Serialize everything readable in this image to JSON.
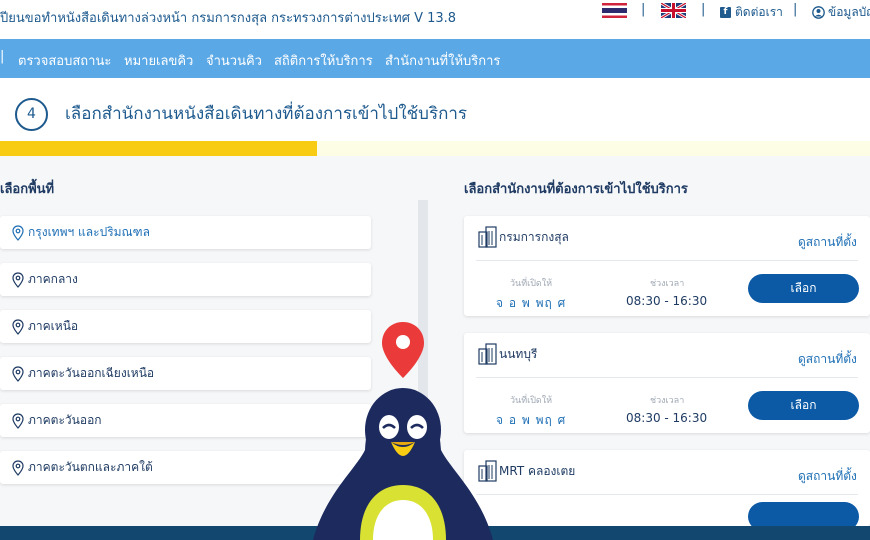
{
  "header": {
    "site_title": "ปียนขอทำหนังสือเดินทางล่วงหน้า กรมการกงสุล กระทรวงการต่างประเทศ V 13.8",
    "contact_label": "ติดต่อเรา",
    "user_label": "ข้อมูลบัญ"
  },
  "nav": {
    "items": [
      "ตรวจสอบสถานะ",
      "หมายเลขคิว",
      "จำนวนคิว",
      "สถิติการให้บริการ",
      "สำนักงานที่ให้บริการ"
    ]
  },
  "step": {
    "number": "4",
    "title": "เลือกสำนักงานหนังสือเดินทางที่ต้องการเข้าไปใช้บริการ",
    "progress_fraction": 0.364
  },
  "regions": {
    "title": "เลือกพื้นที่",
    "items": [
      {
        "label": "กรุงเทพฯ และปริมณฑล",
        "active": true
      },
      {
        "label": "ภาคกลาง",
        "active": false
      },
      {
        "label": "ภาคเหนือ",
        "active": false
      },
      {
        "label": "ภาคตะวันออกเฉียงเหนือ",
        "active": false
      },
      {
        "label": "ภาคตะวันออก",
        "active": false
      },
      {
        "label": "ภาคตะวันตกและภาคใต้",
        "active": false
      }
    ]
  },
  "offices": {
    "title": "เลือกสำนักงานที่ต้องการเข้าไปใช้บริการ",
    "view_label": "ดูสถานที่ตั้ง",
    "days_label": "วันที่เปิดให้",
    "time_label": "ช่วงเวลา",
    "select_label": "เลือก",
    "items": [
      {
        "name": "กรมการกงสุล",
        "days": "จ อ พ พฤ ศ",
        "time": "08:30 - 16:30"
      },
      {
        "name": "นนทบุรี",
        "days": "จ อ พ พฤ ศ",
        "time": "08:30 - 16:30"
      },
      {
        "name": "MRT คลองเตย",
        "days": "",
        "time": ""
      }
    ]
  },
  "colors": {
    "nav_bg": "#5aa8e6",
    "progress_yellow": "#f7cc12",
    "primary_button": "#0c5aa6",
    "footer_bg": "#12476f",
    "pin_red": "#ea3a3a"
  }
}
